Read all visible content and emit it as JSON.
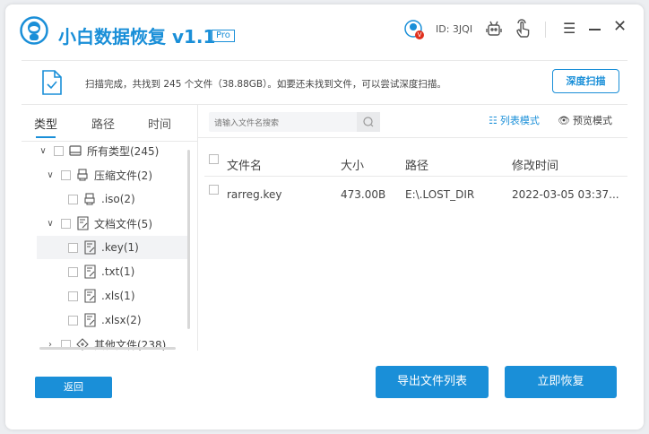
{
  "app": {
    "title": "小白数据恢复 v1.1",
    "badge": "Pro",
    "user_id": "ID: 3JQI",
    "avatar_badge": "V"
  },
  "scan": {
    "message": "扫描完成，共找到 245 个文件（38.88GB）。如要还未找到文件，可以尝试深度扫描。",
    "deep_scan_label": "深度扫描"
  },
  "tabs": [
    {
      "label": "类型",
      "active": true
    },
    {
      "label": "路径"
    },
    {
      "label": "时间"
    }
  ],
  "search": {
    "placeholder": "请输入文件名搜索"
  },
  "view_modes": {
    "list": "列表模式",
    "preview": "预览模式",
    "active": "list"
  },
  "tree": [
    {
      "label": "所有类型(245)",
      "icon": "drive-icon",
      "expanded": true,
      "level": 0
    },
    {
      "label": "压缩文件(2)",
      "icon": "zip-icon",
      "expanded": true,
      "level": 1
    },
    {
      "label": ".iso(2)",
      "icon": "zip-icon",
      "level": 2
    },
    {
      "label": "文档文件(5)",
      "icon": "document-icon",
      "expanded": true,
      "level": 1
    },
    {
      "label": ".key(1)",
      "icon": "document-icon",
      "level": 2,
      "selected": true
    },
    {
      "label": ".txt(1)",
      "icon": "document-icon",
      "level": 2
    },
    {
      "label": ".xls(1)",
      "icon": "document-icon",
      "level": 2
    },
    {
      "label": ".xlsx(2)",
      "icon": "document-icon",
      "level": 2
    },
    {
      "label": "其他文件(238)",
      "icon": "other-icon",
      "expanded": false,
      "level": 1
    }
  ],
  "table": {
    "headers": [
      "文件名",
      "大小",
      "路径",
      "修改时间"
    ],
    "rows": [
      {
        "name": "rarreg.key",
        "size": "473.00B",
        "path": "E:\\.LOST_DIR",
        "modified": "2022-03-05 03:37..."
      }
    ]
  },
  "footer": {
    "back": "返回",
    "export": "导出文件列表",
    "recover": "立即恢复"
  },
  "colors": {
    "accent": "#1a8fd8",
    "badge": "#e0301e"
  }
}
